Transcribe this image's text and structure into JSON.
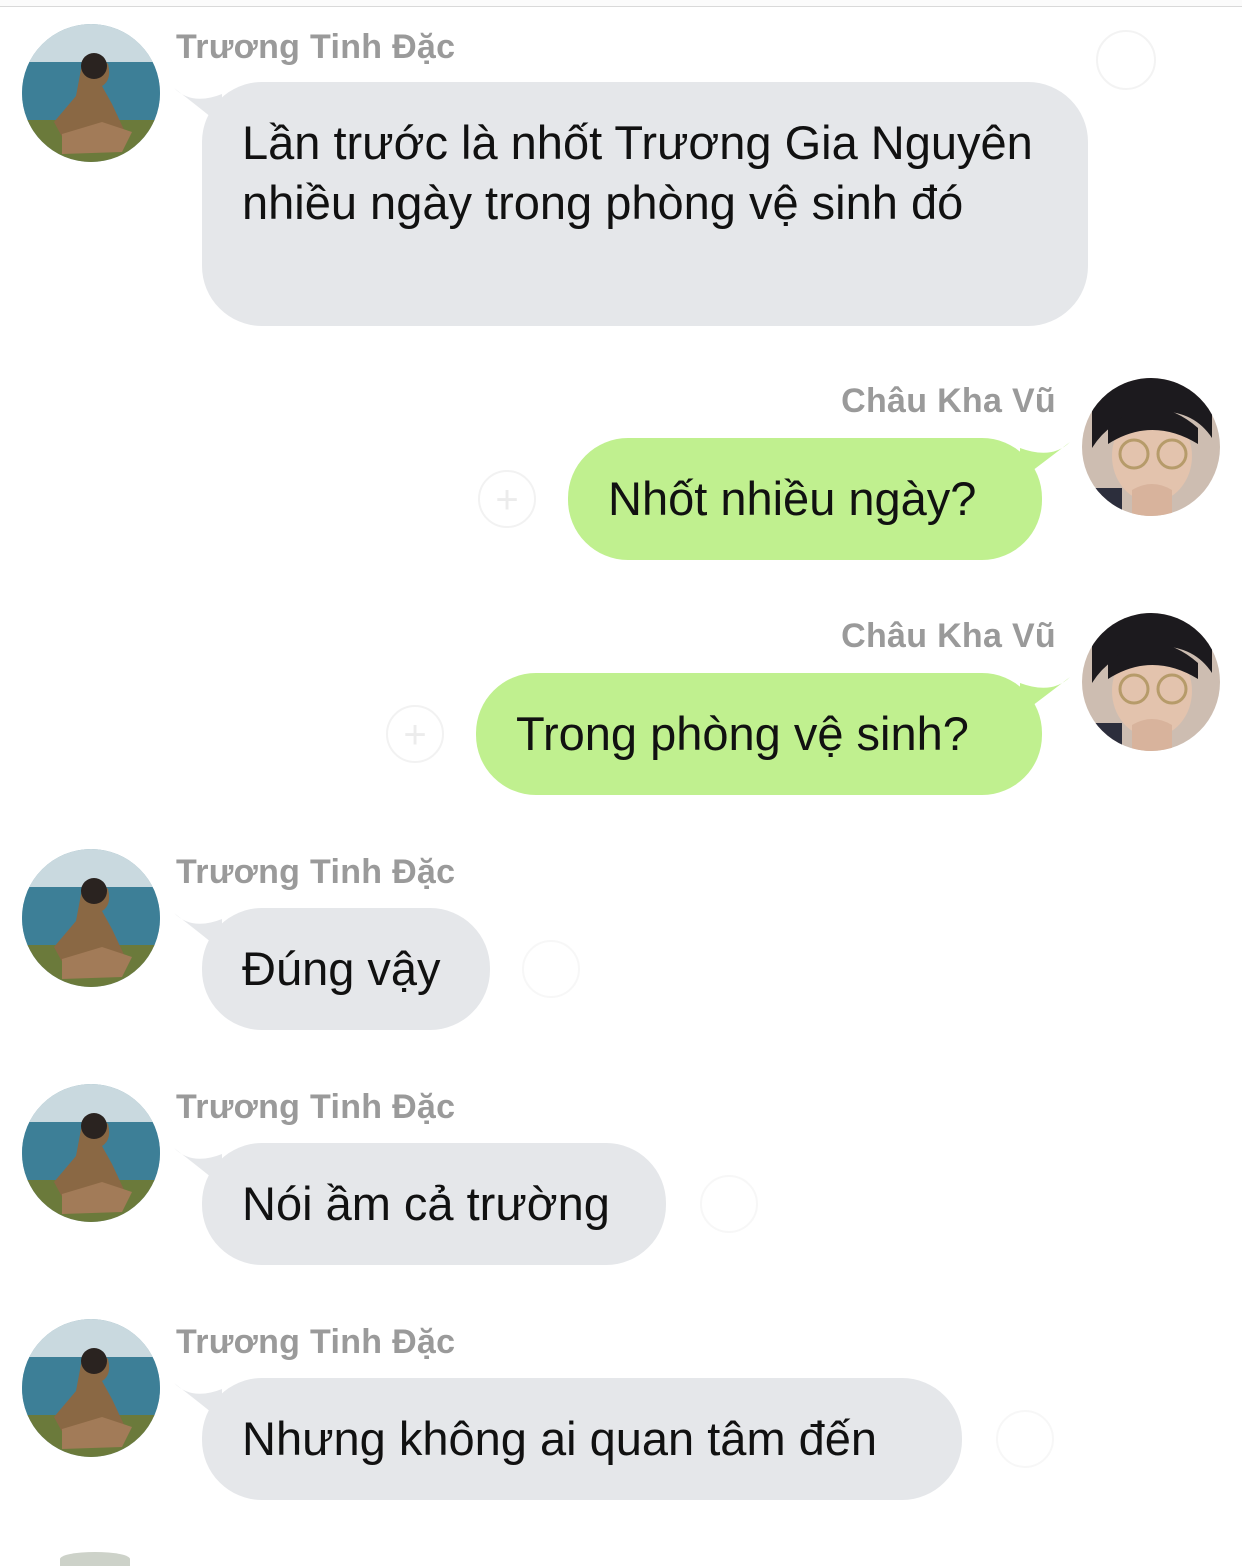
{
  "conversation": {
    "messages": [
      {
        "sender": "Trương Tinh Đặc",
        "direction": "incoming",
        "text": "Lần trước là nhốt Trương Gia Nguyên nhiều ngày trong phòng vệ sinh đó",
        "avatar": "sitting-by-lake-photo"
      },
      {
        "sender": "Châu Kha Vũ",
        "direction": "outgoing",
        "text": "Nhốt nhiều ngày?",
        "avatar": "glasses-portrait-photo"
      },
      {
        "sender": "Châu Kha Vũ",
        "direction": "outgoing",
        "text": "Trong phòng vệ sinh?",
        "avatar": "glasses-portrait-photo"
      },
      {
        "sender": "Trương Tinh Đặc",
        "direction": "incoming",
        "text": "Đúng vậy",
        "avatar": "sitting-by-lake-photo"
      },
      {
        "sender": "Trương Tinh Đặc",
        "direction": "incoming",
        "text": "Nói ầm cả trường",
        "avatar": "sitting-by-lake-photo"
      },
      {
        "sender": "Trương Tinh Đặc",
        "direction": "incoming",
        "text": "Nhưng không ai quan tâm đến",
        "avatar": "sitting-by-lake-photo"
      }
    ]
  },
  "icons": {
    "reaction": "add-reaction-icon",
    "reaction_glyph": "+"
  },
  "colors": {
    "incoming_bubble": "#e5e7ea",
    "outgoing_bubble": "#c0f08f",
    "sender_name": "#9a9a9a",
    "message_text": "#111111",
    "background": "#ffffff"
  }
}
